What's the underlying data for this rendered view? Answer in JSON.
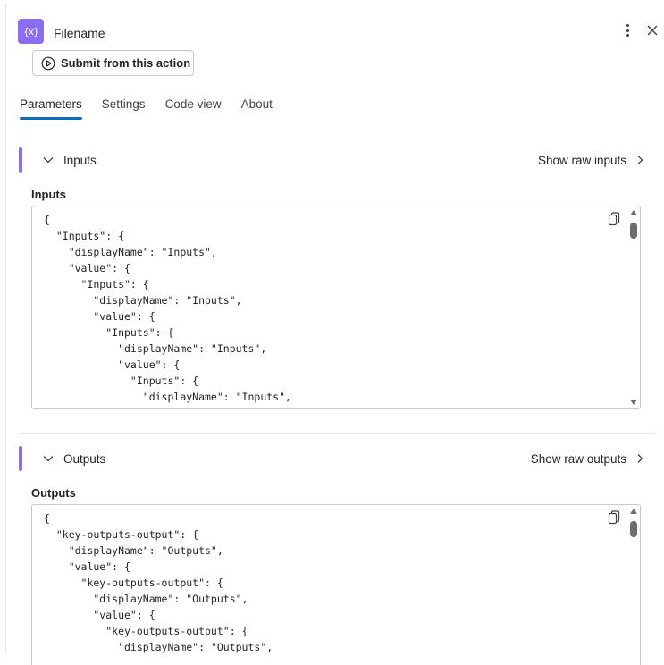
{
  "header": {
    "icon_glyph": "{x}",
    "title": "Filename",
    "submit_label": "Submit from this action"
  },
  "tabs": [
    {
      "label": "Parameters",
      "active": true
    },
    {
      "label": "Settings",
      "active": false
    },
    {
      "label": "Code view",
      "active": false
    },
    {
      "label": "About",
      "active": false
    }
  ],
  "inputs_section": {
    "title": "Inputs",
    "raw_link": "Show raw inputs",
    "field_label": "Inputs",
    "code": "{\n  \"Inputs\": {\n    \"displayName\": \"Inputs\",\n    \"value\": {\n      \"Inputs\": {\n        \"displayName\": \"Inputs\",\n        \"value\": {\n          \"Inputs\": {\n            \"displayName\": \"Inputs\",\n            \"value\": {\n              \"Inputs\": {\n                \"displayName\": \"Inputs\","
  },
  "outputs_section": {
    "title": "Outputs",
    "raw_link": "Show raw outputs",
    "field_label": "Outputs",
    "code": "{\n  \"key-outputs-output\": {\n    \"displayName\": \"Outputs\",\n    \"value\": {\n      \"key-outputs-output\": {\n        \"displayName\": \"Outputs\",\n        \"value\": {\n          \"key-outputs-output\": {\n            \"displayName\": \"Outputs\","
  },
  "colors": {
    "accent": "#8a6cf5",
    "tab_underline": "#0f6cbd"
  }
}
